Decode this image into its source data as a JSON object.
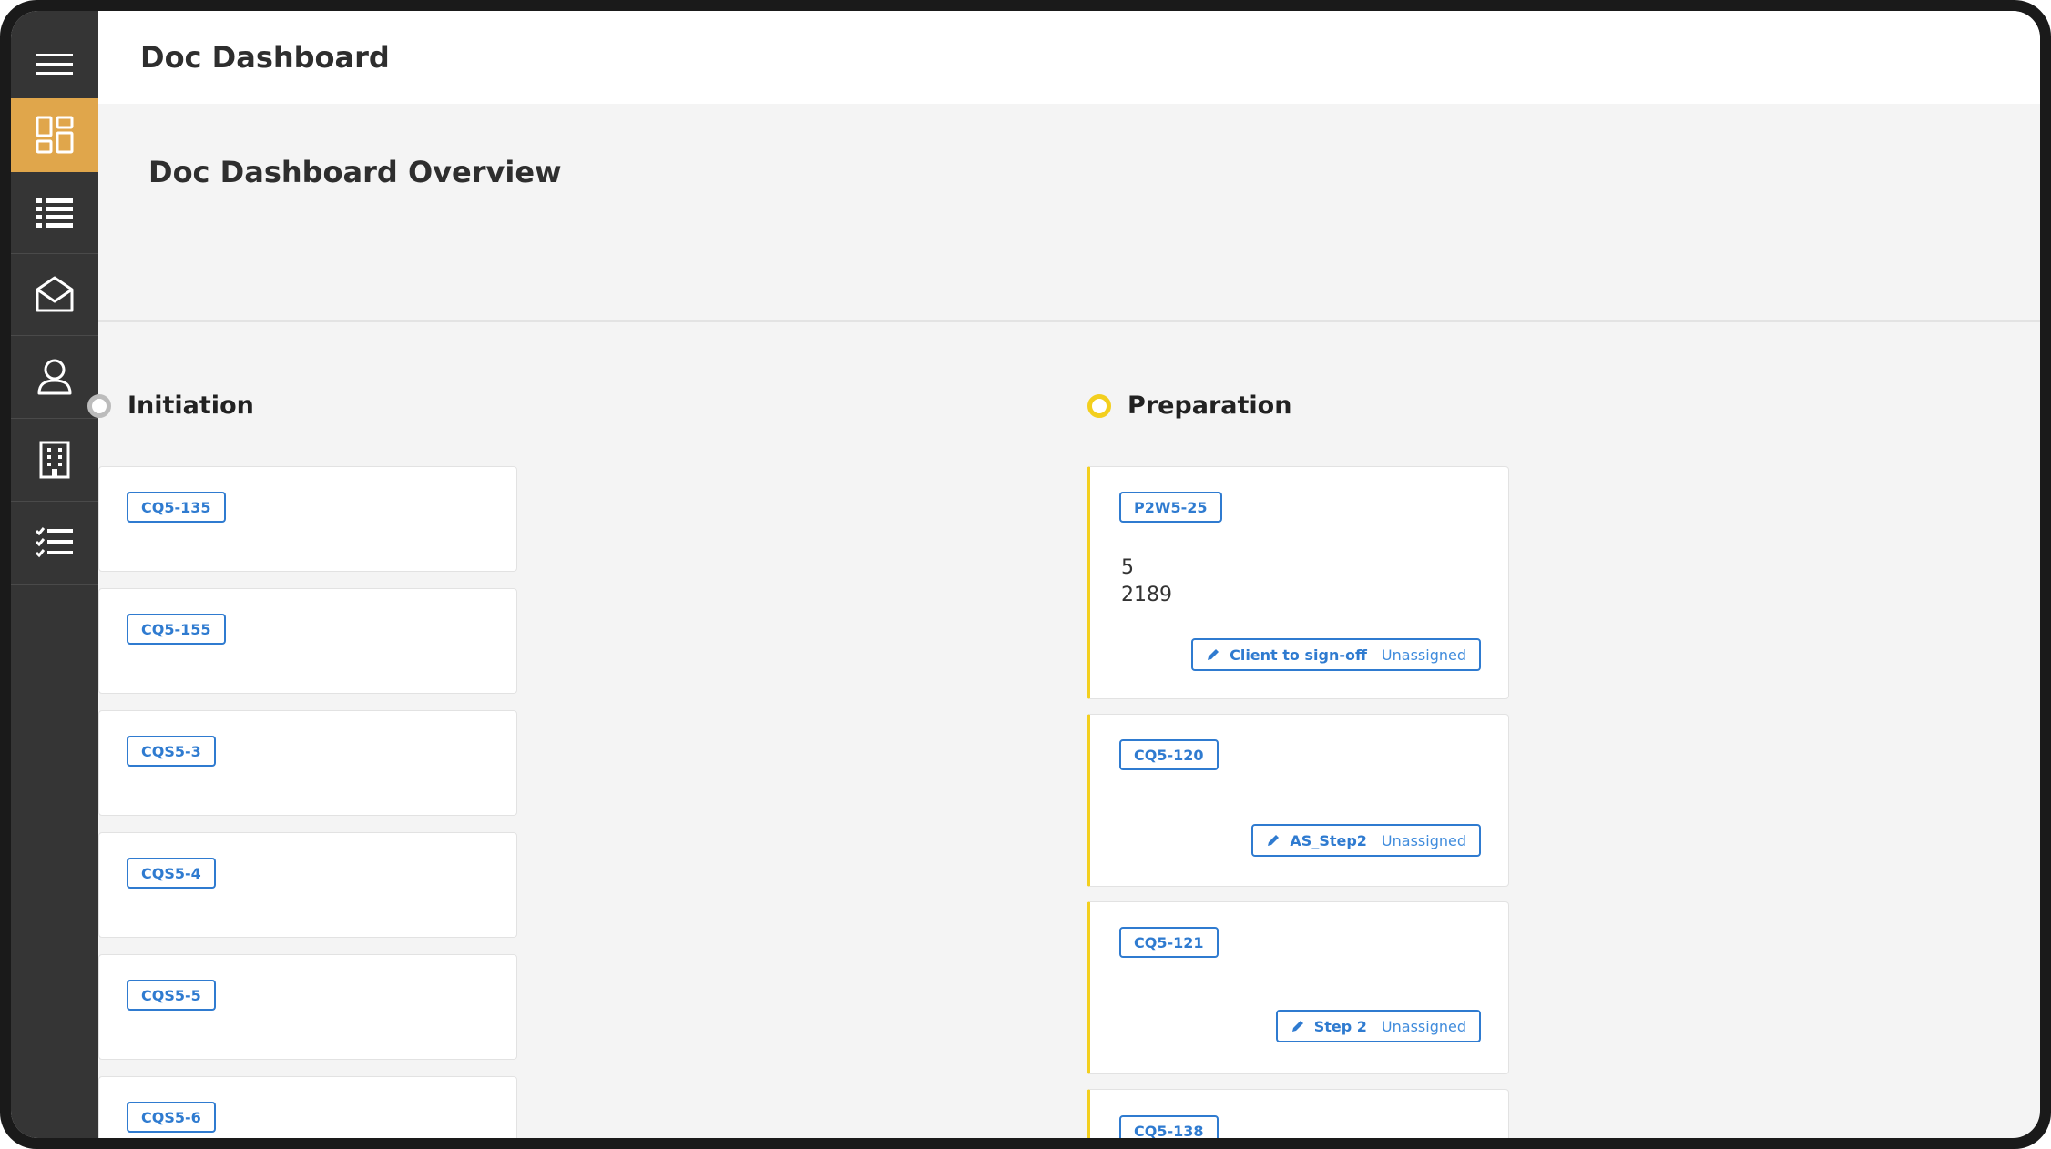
{
  "header": {
    "title": "Doc Dashboard"
  },
  "page": {
    "heading": "Doc Dashboard Overview"
  },
  "sidebar": {
    "items": [
      {
        "icon": "menu-icon"
      },
      {
        "icon": "dashboard-icon",
        "active": true
      },
      {
        "icon": "list-icon"
      },
      {
        "icon": "mail-open-icon"
      },
      {
        "icon": "user-icon"
      },
      {
        "icon": "building-icon"
      },
      {
        "icon": "checklist-icon"
      }
    ]
  },
  "colors": {
    "accent": "#e0a64b",
    "sidebar": "#353535",
    "link": "#2f7bd0",
    "preparation": "#f3cf1e",
    "initiation": "#bcbcbc"
  },
  "columns": {
    "initiation": {
      "title": "Initiation",
      "cards": [
        {
          "tag": "CQ5-135"
        },
        {
          "tag": "CQ5-155"
        },
        {
          "tag": "CQS5-3"
        },
        {
          "tag": "CQS5-4"
        },
        {
          "tag": "CQS5-5"
        },
        {
          "tag": "CQS5-6"
        }
      ]
    },
    "preparation": {
      "title": "Preparation",
      "cards": [
        {
          "tag": "P2W5-25",
          "value1": "5",
          "value2": "2189",
          "step": "Client to sign-off",
          "assignee": "Unassigned"
        },
        {
          "tag": "CQ5-120",
          "step": "AS_Step2",
          "assignee": "Unassigned"
        },
        {
          "tag": "CQ5-121",
          "step": "Step 2",
          "assignee": "Unassigned"
        },
        {
          "tag": "CQ5-138"
        }
      ]
    }
  }
}
